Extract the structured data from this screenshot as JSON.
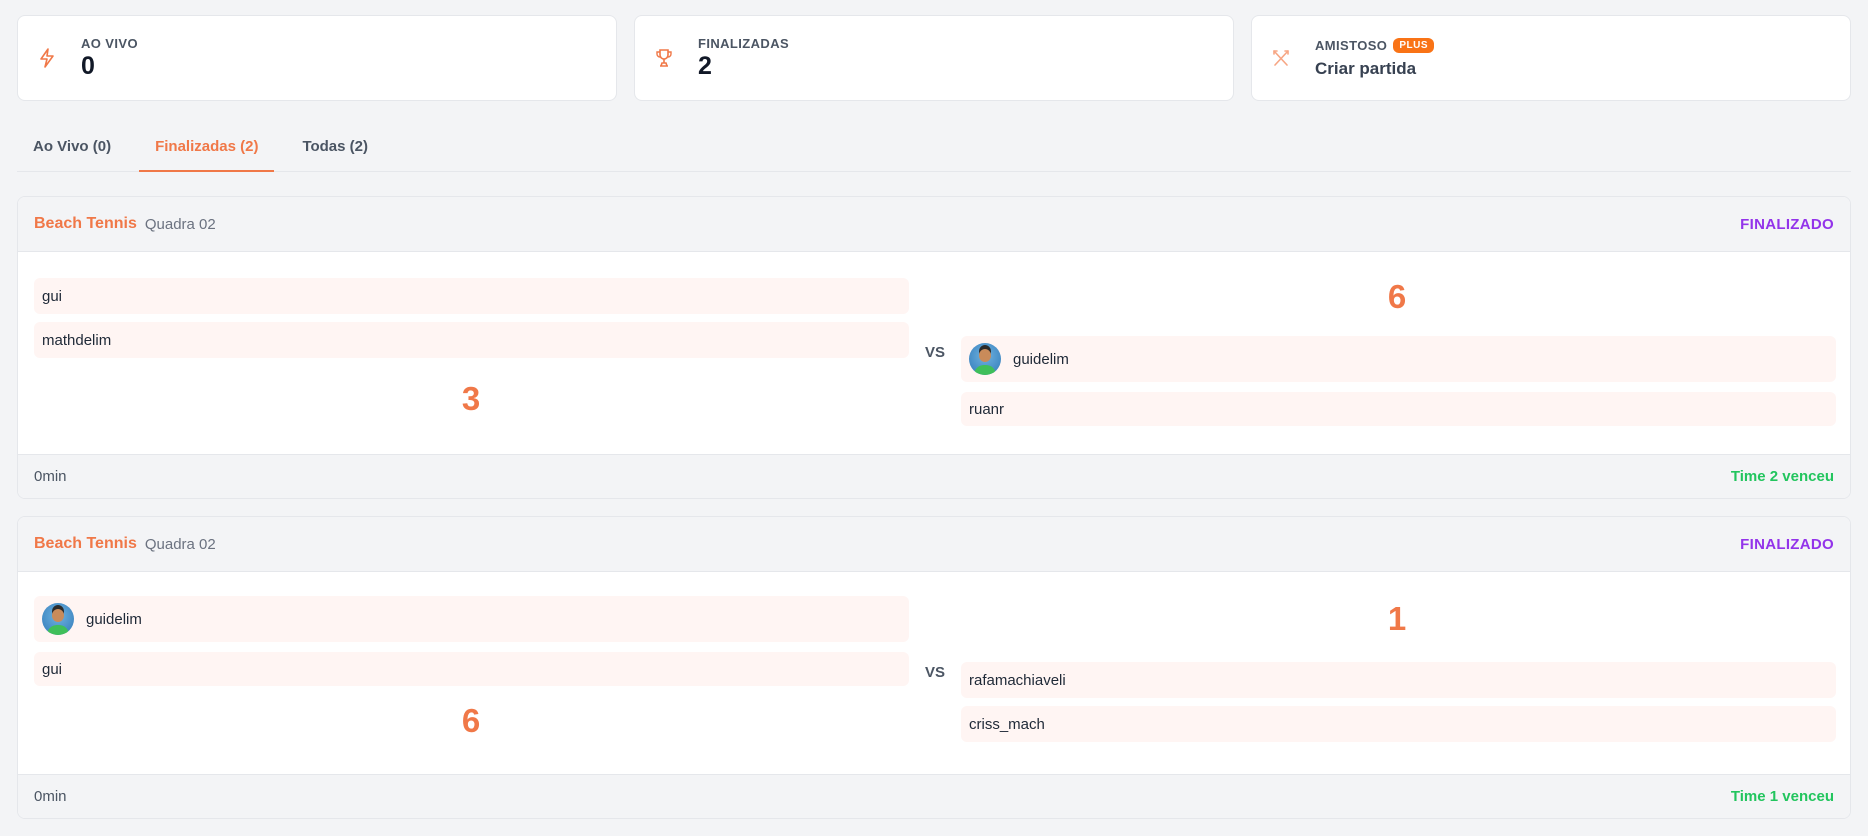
{
  "stats": {
    "live": {
      "label": "AO VIVO",
      "value": "0"
    },
    "finished": {
      "label": "FINALIZADAS",
      "value": "2"
    },
    "friendly": {
      "label": "AMISTOSO",
      "badge": "PLUS",
      "action": "Criar partida"
    }
  },
  "tabs": [
    {
      "label": "Ao Vivo (0)"
    },
    {
      "label": "Finalizadas (2)"
    },
    {
      "label": "Todas (2)"
    }
  ],
  "vs_label": "VS",
  "matches": [
    {
      "sport": "Beach Tennis",
      "court": "Quadra 02",
      "status": "FINALIZADO",
      "team1": {
        "players": [
          "gui",
          "mathdelim"
        ],
        "score": "3"
      },
      "team2": {
        "players": [
          "guidelim",
          "ruanr"
        ],
        "score": "6"
      },
      "duration": "0min",
      "result": "Time 2 venceu"
    },
    {
      "sport": "Beach Tennis",
      "court": "Quadra 02",
      "status": "FINALIZADO",
      "team1": {
        "players": [
          "guidelim",
          "gui"
        ],
        "score": "6"
      },
      "team2": {
        "players": [
          "rafamachiaveli",
          "criss_mach"
        ],
        "score": "1"
      },
      "duration": "0min",
      "result": "Time 1 venceu"
    }
  ],
  "colors": {
    "accent": "#f07848",
    "status": "#9333ea",
    "winner": "#22c55e",
    "player_bg": "#fff5f3"
  },
  "icons": {
    "live": "lightning-icon",
    "finished": "trophy-icon",
    "friendly": "crossed-rackets-icon",
    "avatar": "user-avatar"
  }
}
